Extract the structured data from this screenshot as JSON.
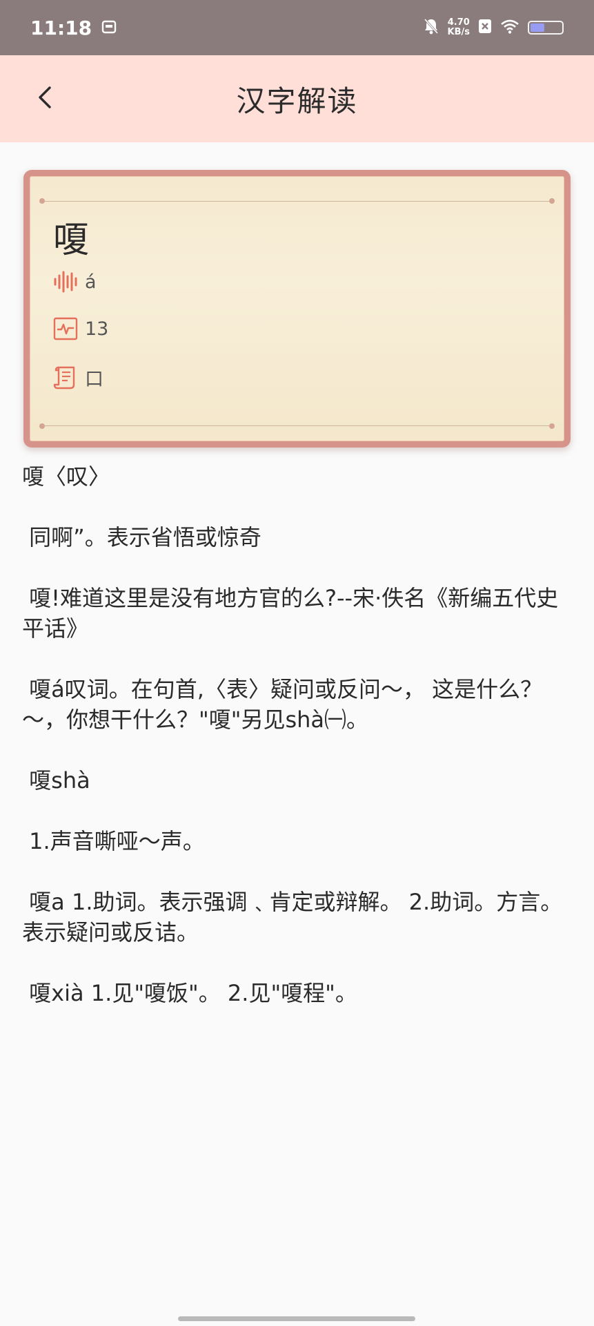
{
  "status_bar": {
    "time": "11:18",
    "net_speed_value": "4.70",
    "net_speed_unit": "KB/s",
    "battery_level": 0.45,
    "battery_color": "#9aa0ff"
  },
  "header": {
    "title": "汉字解读",
    "back_icon": "chevron-left-icon",
    "background": "#ffdfd8"
  },
  "card": {
    "character": "嗄",
    "pinyin": "á",
    "strokes": "13",
    "radical": "口",
    "accent_color": "#e4705c",
    "icons": [
      "sound-wave-icon",
      "stroke-pulse-icon",
      "scroll-radical-icon"
    ]
  },
  "definitions": [
    "嗄〈叹〉",
    " 同啊”。表示省悟或惊奇",
    " 嗄!难道这里是没有地方官的么?--宋·佚名《新编五代史平话》",
    " 嗄á叹词。在句首,〈表〉疑问或反问～， 这是什么？ ～，你想干什么？\"嗄\"另见shà㈠。",
    " 嗄shà",
    " 1.声音嘶哑～声。",
    " 嗄a 1.助词。表示强调﹑肯定或辩解。 2.助词。方言。表示疑问或反诘。",
    " 嗄xià 1.见\"嗄饭\"。 2.见\"嗄程\"。"
  ]
}
